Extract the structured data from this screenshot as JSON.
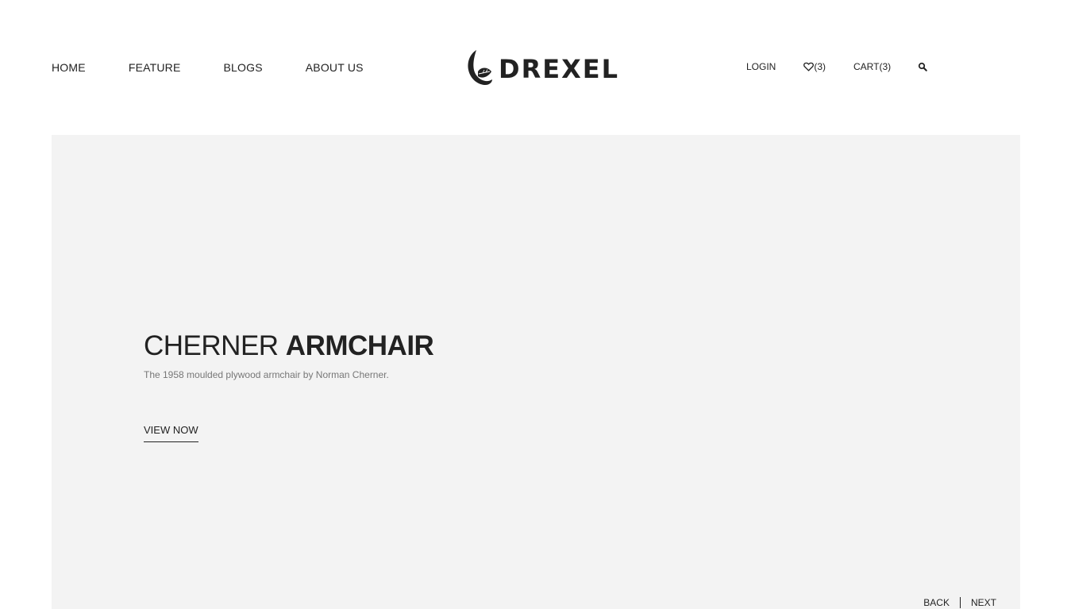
{
  "brand": {
    "name": "DREXEL"
  },
  "nav_left": {
    "items": [
      {
        "label": "HOME"
      },
      {
        "label": "FEATURE"
      },
      {
        "label": "BLOGS"
      },
      {
        "label": "ABOUT US"
      }
    ]
  },
  "nav_right": {
    "login": "LOGIN",
    "wishlist_count": "(3)",
    "cart": "CART(3)",
    "search_icon": "search-icon",
    "heart_icon": "heart-icon"
  },
  "hero": {
    "title_light": "CHERNER ",
    "title_bold": "ARMCHAIR",
    "subtitle": "The 1958 moulded plywood armchair by Norman Cherner.",
    "cta": "VIEW NOW",
    "back": "BACK",
    "next": "NEXT",
    "background_color": "#f3f3f3"
  }
}
